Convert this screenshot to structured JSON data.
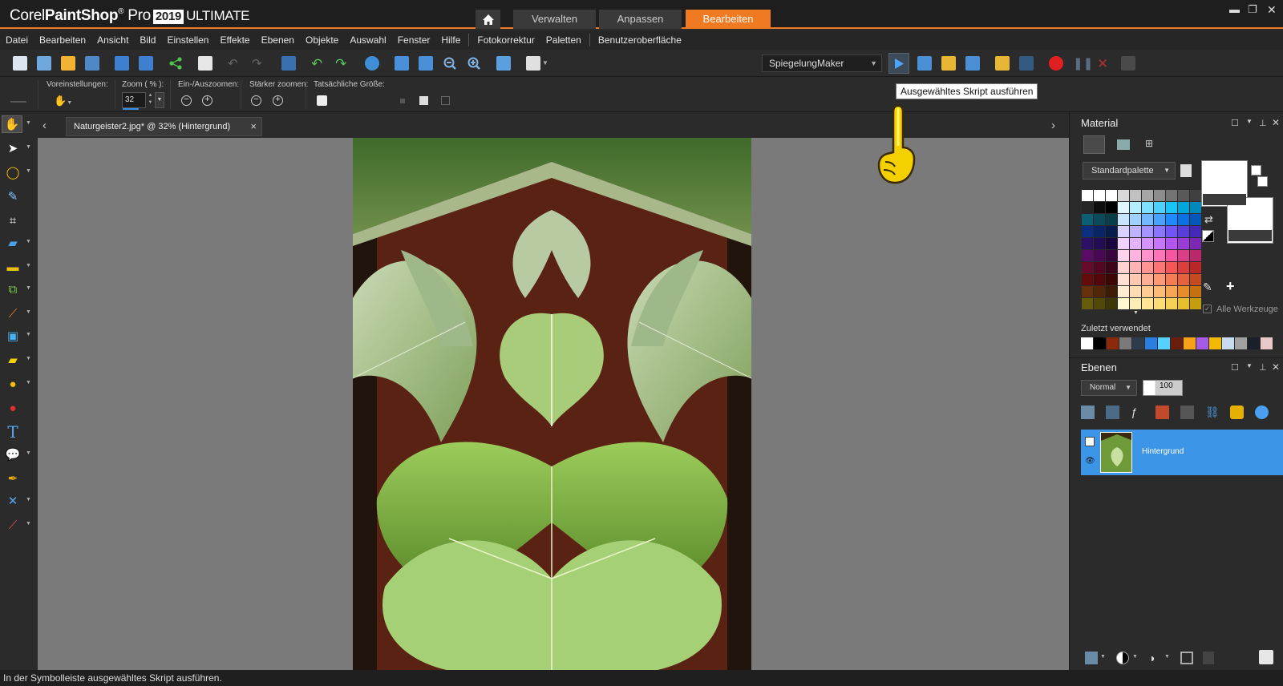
{
  "app": {
    "brand_corel": "Corel",
    "brand_product": "PaintShop",
    "brand_pro": "Pro",
    "brand_year": "2019",
    "brand_edition": "ULTIMATE"
  },
  "workspace_tabs": [
    {
      "label": "Verwalten",
      "active": false
    },
    {
      "label": "Anpassen",
      "active": false
    },
    {
      "label": "Bearbeiten",
      "active": true
    }
  ],
  "menu": [
    "Datei",
    "Bearbeiten",
    "Ansicht",
    "Bild",
    "Einstellen",
    "Effekte",
    "Ebenen",
    "Objekte",
    "Auswahl",
    "Fenster",
    "Hilfe",
    "Fotokorrektur",
    "Paletten",
    "Benutzeroberfläche"
  ],
  "toolbar": {
    "script_select_value": "SpiegelungMaker",
    "run_script_tooltip": "Ausgewähltes Skript ausführen"
  },
  "options": {
    "presets_label": "Voreinstellungen:",
    "zoom_label": "Zoom ( % ):",
    "zoom_value": "32",
    "inout_label": "Ein-/Auszoomen:",
    "stronger_label": "Stärker zoomen:",
    "actual_size_label": "Tatsächliche Größe:"
  },
  "document": {
    "tab_title": "Naturgeister2.jpg* @  32% (Hintergrund)",
    "zoom_percent": 32
  },
  "status": {
    "text": "In der Symbolleiste ausgewähltes Skript ausführen."
  },
  "materials": {
    "title": "Material",
    "palette_select": "Standardpalette",
    "recent_label": "Zuletzt verwendet",
    "all_tools_label": "Alle Werkzeuge",
    "foreground_color": "#ffffff",
    "background_color": "#ffffff",
    "swatches": [
      "#ffffff",
      "#ffffff",
      "#ffffff",
      "#d9d9d9",
      "#c0c0c0",
      "#a6a6a6",
      "#8c8c8c",
      "#737373",
      "#595959",
      "#404040",
      "#262626",
      "#0d0d0d",
      "#000000",
      "#e0f7ff",
      "#b3eeff",
      "#80e0ff",
      "#4dd2ff",
      "#1ac3f5",
      "#00a6dc",
      "#0088b8",
      "#0b5e73",
      "#0b4a5a",
      "#083d4a",
      "#c8e5ff",
      "#9fd0ff",
      "#74b9ff",
      "#4aa2ff",
      "#1f8aff",
      "#0b6fe6",
      "#0856b8",
      "#0b2f80",
      "#0a2566",
      "#081c4d",
      "#d9d2ff",
      "#bfb3ff",
      "#a594ff",
      "#8b75ff",
      "#7156f5",
      "#5a3ddc",
      "#4428b8",
      "#2c1066",
      "#220c52",
      "#18083d",
      "#f0d2ff",
      "#e3b3ff",
      "#d494ff",
      "#c675ff",
      "#b256f0",
      "#9a3dd6",
      "#7d28b0",
      "#5a0b66",
      "#4a0852",
      "#38063d",
      "#ffd2ee",
      "#ffb3de",
      "#ff94cc",
      "#ff75b8",
      "#f556a0",
      "#dc3d86",
      "#b8286a",
      "#660b2c",
      "#520822",
      "#3d0618",
      "#ffd2d2",
      "#ffb3b3",
      "#ff9494",
      "#ff7575",
      "#f55656",
      "#dc3d3d",
      "#b82828",
      "#660b0b",
      "#520808",
      "#3d0606",
      "#ffe0d2",
      "#ffc8b3",
      "#ffb094",
      "#ff9875",
      "#f57d56",
      "#e6623d",
      "#c44a20",
      "#66300b",
      "#522608",
      "#3d1c06",
      "#ffecd2",
      "#ffdcb3",
      "#ffcc94",
      "#ffbb75",
      "#f5a656",
      "#e68d2a",
      "#c4720f",
      "#665a0b",
      "#524808",
      "#3d3606",
      "#fff6d2",
      "#ffeeb3",
      "#ffe594",
      "#ffdc75",
      "#f5cf56",
      "#e6bd2a",
      "#c49e0f"
    ],
    "recent": [
      "#ffffff",
      "#000000",
      "#8a2a0a",
      "#7a7a7a",
      "#2f3a4a",
      "#2a7de1",
      "#55d0ff",
      "#6a1e0a",
      "#f7a01a",
      "#a45ce8",
      "#f5b800",
      "#c8daf0",
      "#a0a0a0",
      "#1a1f2a",
      "#e8c8c8"
    ]
  },
  "layers": {
    "title": "Ebenen",
    "blend_mode": "Normal",
    "opacity": "100",
    "items": [
      {
        "name": "Hintergrund",
        "selected": true
      }
    ]
  }
}
